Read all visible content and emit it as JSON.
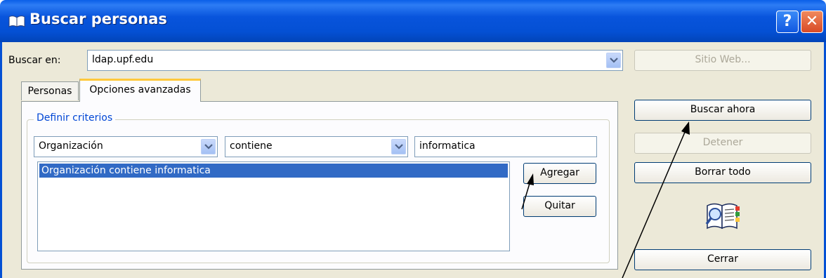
{
  "window": {
    "title": "Buscar personas",
    "help_label": "?",
    "close_label": "✕"
  },
  "search_in": {
    "label": "Buscar en:",
    "value": "ldap.upf.edu"
  },
  "tabs": [
    {
      "label": "Personas"
    },
    {
      "label": "Opciones avanzadas"
    }
  ],
  "criteria": {
    "group_label": "Definir criterios",
    "field_value": "Organización",
    "operator_value": "contiene",
    "text_value": "informatica",
    "list_items": [
      "Organización contiene informatica"
    ]
  },
  "buttons": {
    "website": "Sitio Web...",
    "search_now": "Buscar ahora",
    "stop": "Detener",
    "clear_all": "Borrar todo",
    "add": "Agregar",
    "remove": "Quitar",
    "close": "Cerrar"
  },
  "icons": {
    "app": "address-book-icon",
    "dropdown": "chevron-down-icon",
    "search_book": "search-book-icon"
  },
  "colors": {
    "titlebar": "#0450d4",
    "dialog_bg": "#ece9d8",
    "selection": "#316ac5",
    "tab_accent": "#ffc83c",
    "group_label": "#0046d5"
  }
}
